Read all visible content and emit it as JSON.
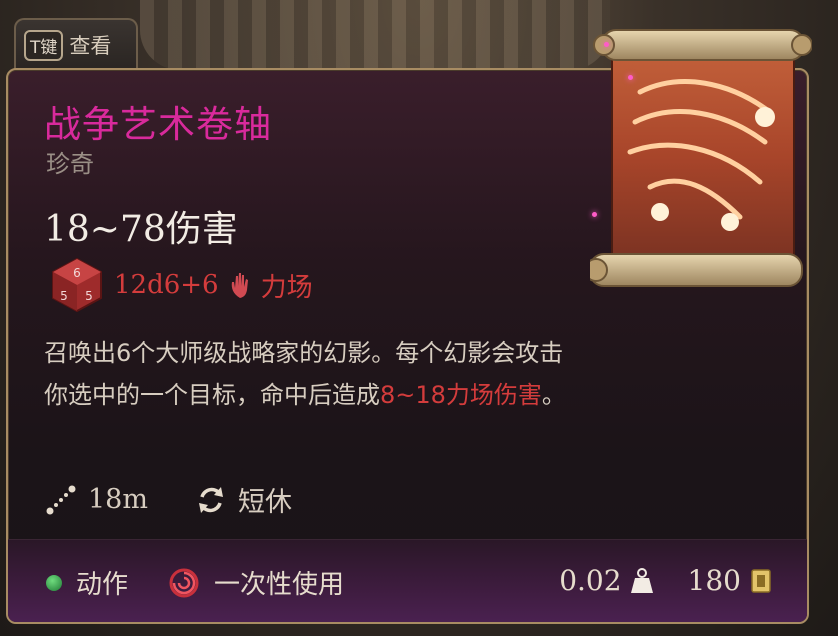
{
  "hotkey": {
    "key": "T键",
    "label": "查看"
  },
  "item": {
    "name": "战争艺术卷轴",
    "rarity": "珍奇",
    "damage": "18~78伤害",
    "dice": "12d6+6",
    "damage_type": "力场",
    "description_part1": "召唤出6个大师级战略家的幻影。每个幻影会攻击你选中的一个目标，命中后造成",
    "description_highlight": "8~18力场伤害",
    "description_part2": "。",
    "range": "18m",
    "recharge": "短休"
  },
  "footer": {
    "action": "动作",
    "usage": "一次性使用",
    "weight": "0.02",
    "value": "180"
  },
  "colors": {
    "title": "#d92a9c",
    "damage_red": "#d43c3c",
    "action_green": "#3fb85a",
    "border_gold": "#a88c63"
  },
  "icons": [
    "dice-icon",
    "force-hand-icon",
    "range-icon",
    "short-rest-icon",
    "action-dot-icon",
    "single-use-swirl-icon",
    "weight-icon",
    "gold-coin-icon",
    "scroll-artwork"
  ]
}
